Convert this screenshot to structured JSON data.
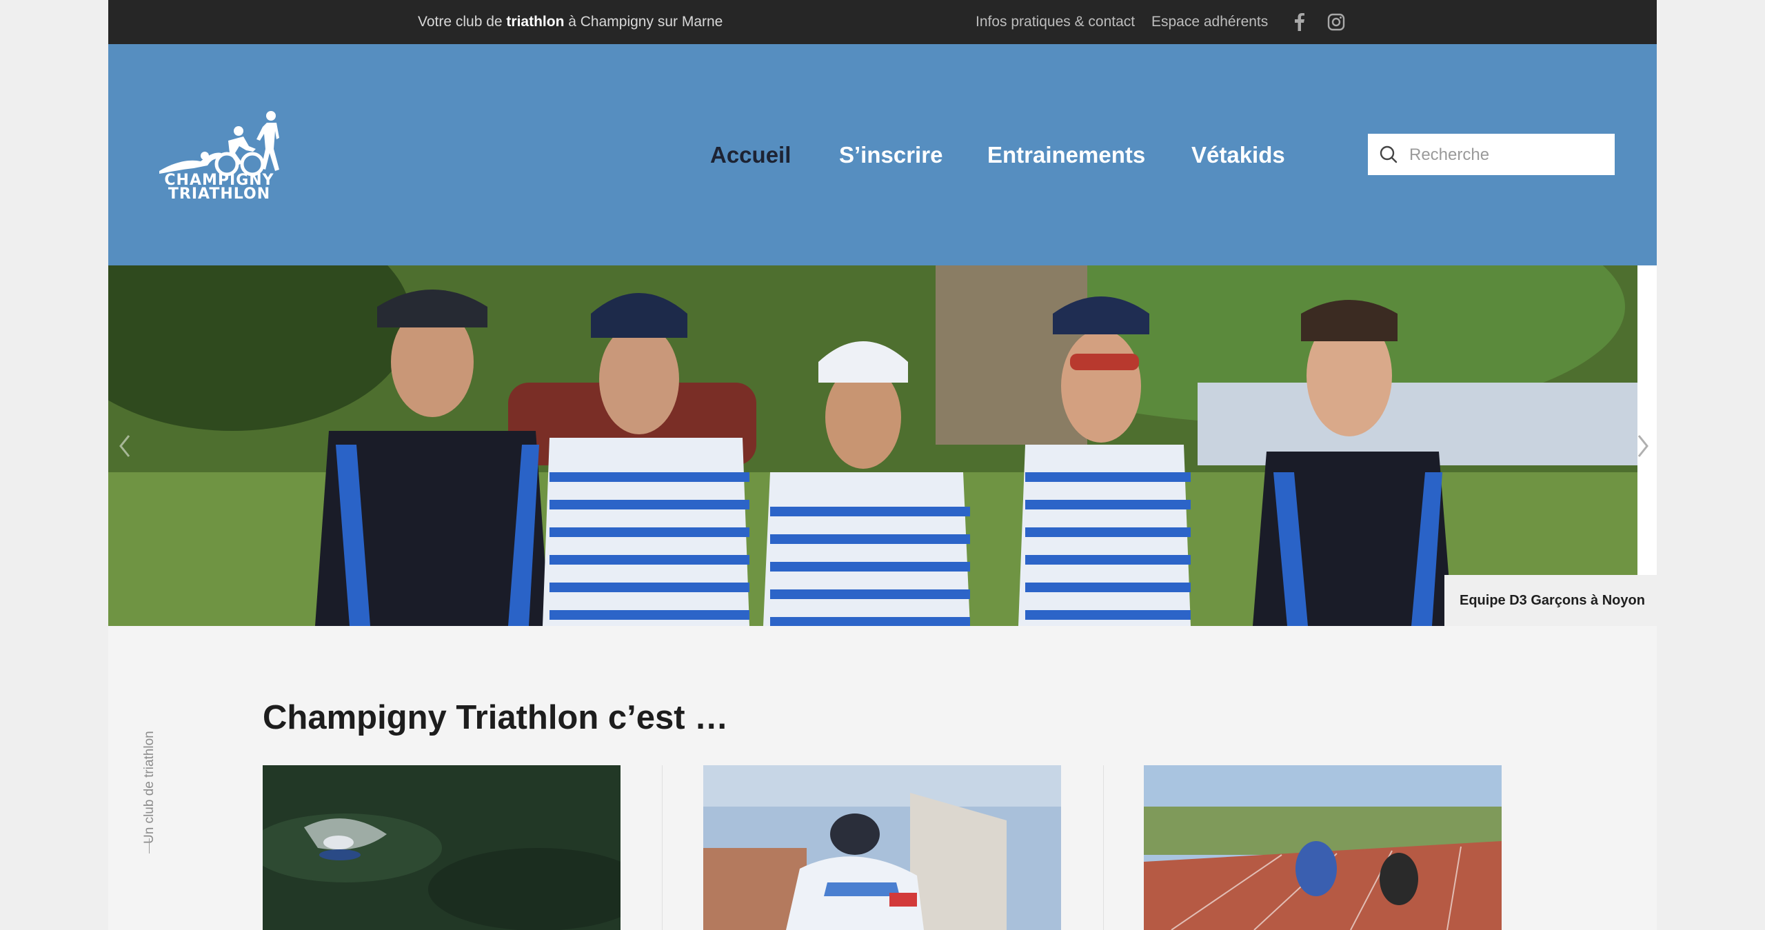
{
  "topbar": {
    "tagline_prefix": "Votre club de ",
    "tagline_bold": "triathlon",
    "tagline_suffix": " à Champigny sur Marne",
    "links": [
      "Infos pratiques & contact",
      "Espace adhérents"
    ],
    "social_icons": [
      "facebook-icon",
      "instagram-icon"
    ]
  },
  "header": {
    "logo_line1": "CHAMPIGNY",
    "logo_line2": "TRIATHLON",
    "nav": [
      {
        "label": "Accueil",
        "active": true
      },
      {
        "label": "S’inscrire",
        "active": false
      },
      {
        "label": "Entrainements",
        "active": false
      },
      {
        "label": "Vétakids",
        "active": false
      }
    ],
    "search_placeholder": "Recherche"
  },
  "slider": {
    "caption": "Equipe D3 Garçons à Noyon",
    "arrows": [
      "chevron-left-icon",
      "chevron-right-icon"
    ]
  },
  "section": {
    "vertical_label": "Un club de triathlon",
    "title": "Champigny Triathlon c’est …"
  },
  "colors": {
    "topbar_bg": "#262626",
    "header_bg": "#568ec0",
    "nav_active": "#1d2333",
    "page_bg": "#f4f4f4"
  }
}
